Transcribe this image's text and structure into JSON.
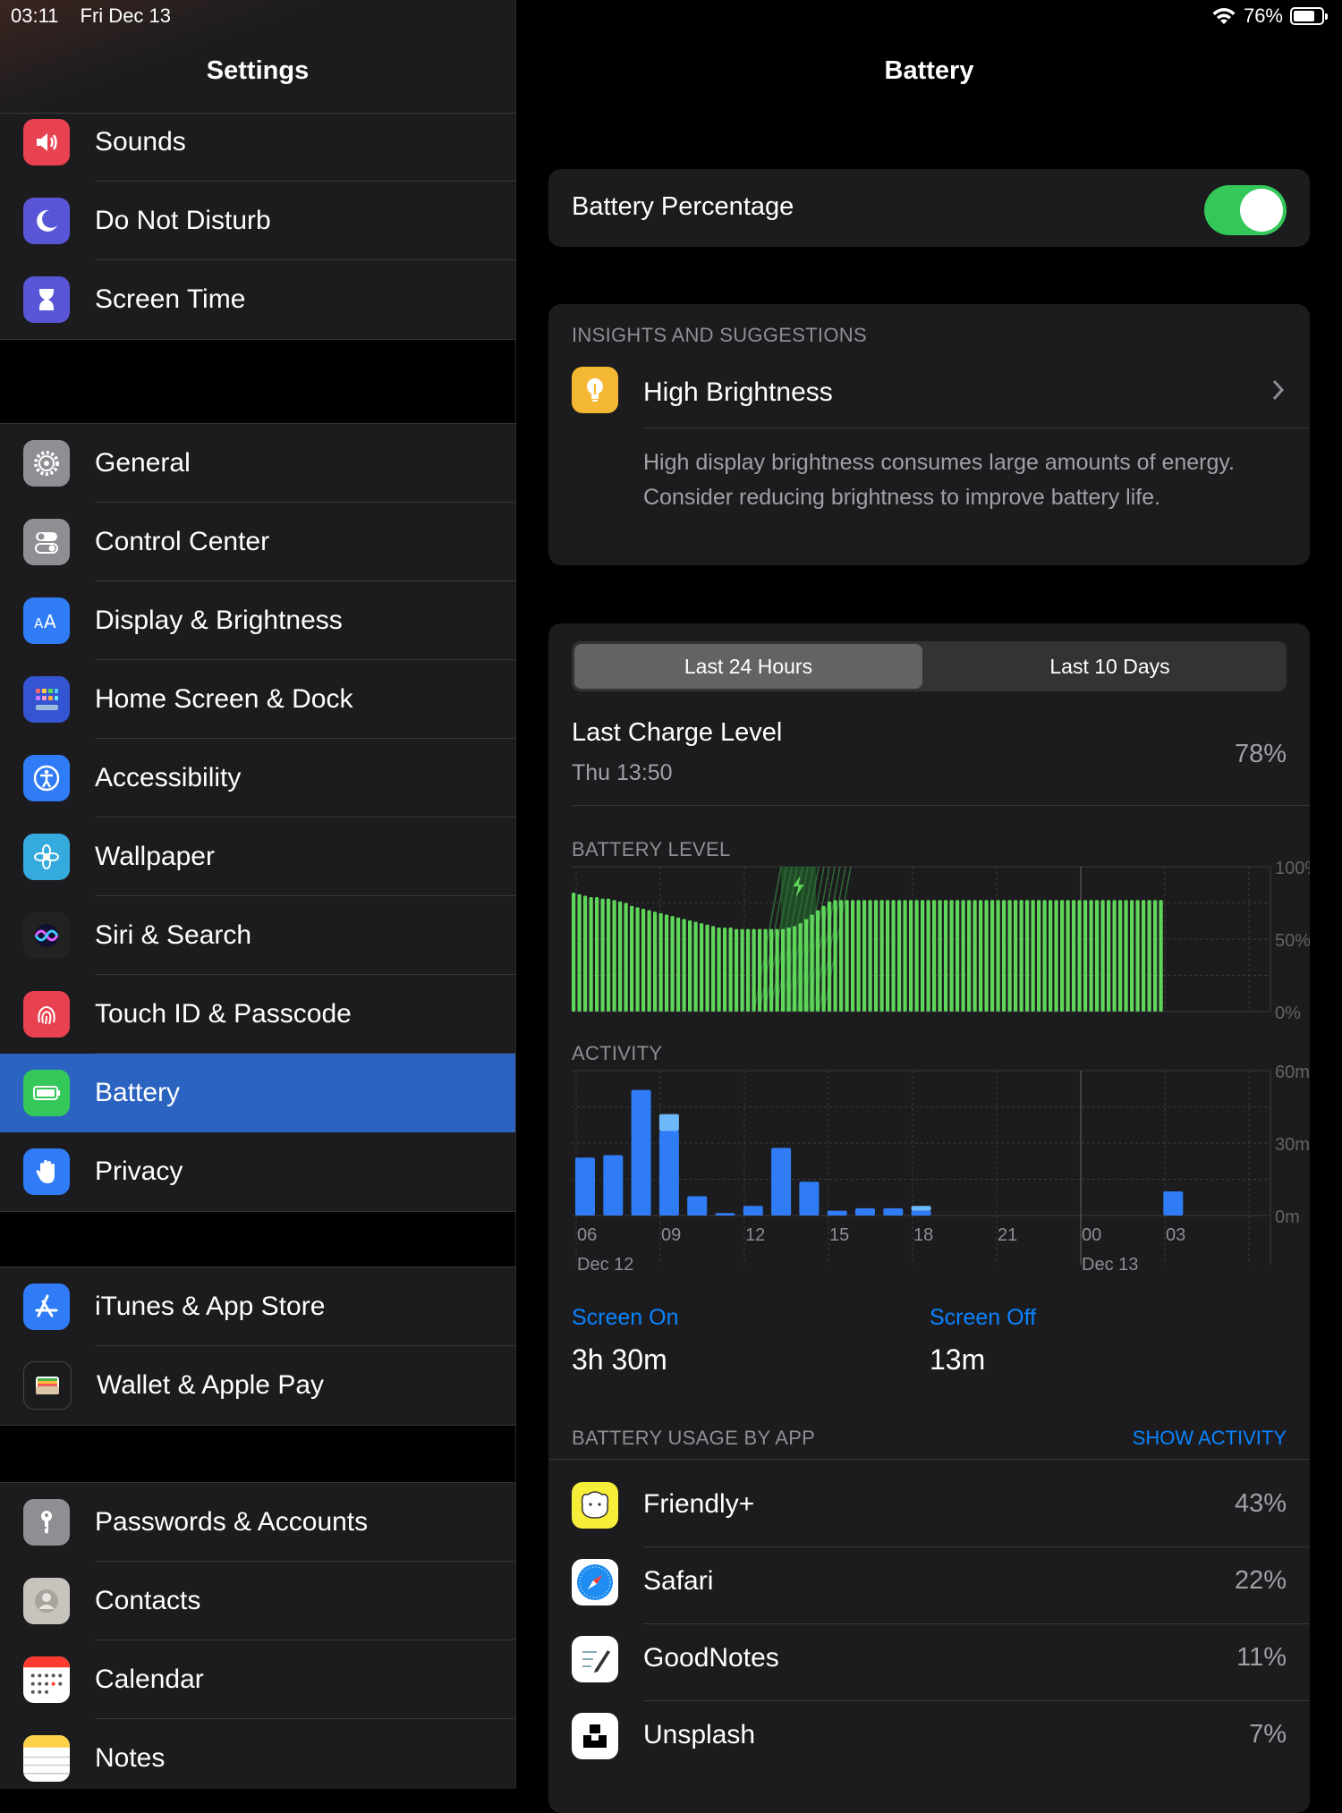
{
  "status_bar": {
    "time": "03:11",
    "date": "Fri Dec 13",
    "battery_percent": "76%",
    "battery_level": 0.76
  },
  "sidebar": {
    "title": "Settings",
    "groups": [
      [
        {
          "label": "Sounds",
          "icon": "speaker-icon",
          "color": "#e8414f"
        },
        {
          "label": "Do Not Disturb",
          "icon": "moon-icon",
          "color": "#5856d6"
        },
        {
          "label": "Screen Time",
          "icon": "hourglass-icon",
          "color": "#5856d6"
        }
      ],
      [
        {
          "label": "General",
          "icon": "gear-icon",
          "color": "#8e8e93"
        },
        {
          "label": "Control Center",
          "icon": "switches-icon",
          "color": "#8e8e93"
        },
        {
          "label": "Display & Brightness",
          "icon": "text-size-icon",
          "color": "#2f7cf6"
        },
        {
          "label": "Home Screen & Dock",
          "icon": "app-grid-icon",
          "color": "#3455d1"
        },
        {
          "label": "Accessibility",
          "icon": "accessibility-icon",
          "color": "#2f7cf6"
        },
        {
          "label": "Wallpaper",
          "icon": "flower-icon",
          "color": "#35aadc"
        },
        {
          "label": "Siri & Search",
          "icon": "siri-icon",
          "color": "#222222"
        },
        {
          "label": "Touch ID & Passcode",
          "icon": "fingerprint-icon",
          "color": "#e8414f"
        },
        {
          "label": "Battery",
          "icon": "battery-icon",
          "color": "#34c759",
          "selected": true
        },
        {
          "label": "Privacy",
          "icon": "hand-icon",
          "color": "#2f7cf6"
        }
      ],
      [
        {
          "label": "iTunes & App Store",
          "icon": "app-store-icon",
          "color": "#2f7cf6"
        },
        {
          "label": "Wallet & Apple Pay",
          "icon": "wallet-icon",
          "color": "#1c1c1e"
        }
      ],
      [
        {
          "label": "Passwords & Accounts",
          "icon": "key-icon",
          "color": "#8e8e93"
        },
        {
          "label": "Contacts",
          "icon": "contacts-icon",
          "color": "#c8c3bc"
        },
        {
          "label": "Calendar",
          "icon": "calendar-icon",
          "color": "#ffffff"
        },
        {
          "label": "Notes",
          "icon": "notes-icon",
          "color": "#ffffff"
        }
      ]
    ]
  },
  "detail": {
    "title": "Battery",
    "battery_percentage": {
      "label": "Battery Percentage",
      "on": true
    },
    "insights": {
      "header": "INSIGHTS AND SUGGESTIONS",
      "item": "High Brightness",
      "description": "High display brightness consumes large amounts of energy. Consider reducing brightness to improve battery life."
    },
    "segments": {
      "selected": "Last 24 Hours",
      "other": "Last 10 Days"
    },
    "last_charge": {
      "label": "Last Charge Level",
      "time": "Thu 13:50",
      "value": "78%"
    },
    "battery_level_chart": {
      "label": "BATTERY LEVEL",
      "y_ticks": [
        "100%",
        "50%",
        "0%"
      ],
      "values": [
        82,
        81,
        80,
        79,
        79,
        78,
        78,
        77,
        76,
        75,
        73,
        72,
        71,
        70,
        69,
        68,
        67,
        66,
        65,
        64,
        63,
        62,
        61,
        60,
        59,
        58,
        58,
        58,
        57,
        57,
        57,
        57,
        57,
        57,
        57,
        57,
        57,
        58,
        59,
        61,
        64,
        67,
        70,
        73,
        76,
        77,
        77,
        77,
        77,
        77,
        77,
        77,
        77,
        77,
        77,
        77,
        77,
        77,
        77,
        77,
        77,
        77,
        77,
        77,
        77,
        77,
        77,
        77,
        77,
        77,
        77,
        77,
        77,
        77,
        77,
        77,
        77,
        77,
        77,
        77,
        77,
        77,
        77,
        77,
        77,
        77,
        77,
        77,
        77,
        77,
        77,
        77,
        77,
        77,
        77,
        77,
        77,
        77,
        77,
        77,
        77,
        77
      ],
      "charging_start": 36,
      "charging_end": 41
    },
    "activity_chart": {
      "label": "ACTIVITY",
      "y_ticks": [
        "60m",
        "30m",
        "0m"
      ],
      "x_labels": [
        "06",
        "09",
        "12",
        "15",
        "18",
        "21",
        "00",
        "03"
      ],
      "date_labels": [
        "Dec 12",
        "Dec 13"
      ],
      "screen_on": [
        24,
        25,
        52,
        35,
        8,
        1,
        4,
        28,
        14,
        2,
        3,
        3,
        2,
        0,
        0,
        0,
        0,
        0,
        0,
        0,
        0,
        10
      ],
      "screen_off": [
        0,
        0,
        0,
        7,
        0,
        0,
        0,
        0,
        0,
        0,
        0,
        0,
        2,
        0,
        0,
        0,
        0,
        0,
        0,
        0,
        0,
        0
      ]
    },
    "screen_on": {
      "label": "Screen On",
      "value": "3h 30m"
    },
    "screen_off": {
      "label": "Screen Off",
      "value": "13m"
    },
    "usage": {
      "header": "BATTERY USAGE BY APP",
      "show_activity": "SHOW ACTIVITY",
      "apps": [
        {
          "name": "Friendly+",
          "value": "43%",
          "icon": "friendly-icon"
        },
        {
          "name": "Safari",
          "value": "22%",
          "icon": "safari-icon"
        },
        {
          "name": "GoodNotes",
          "value": "11%",
          "icon": "goodnotes-icon"
        },
        {
          "name": "Unsplash",
          "value": "7%",
          "icon": "unsplash-icon"
        }
      ]
    },
    "colors": {
      "accent": "#0a84ff",
      "battery_green": "#5fd65a",
      "toggle_on": "#34c759",
      "screen_on": "#2f7cf6",
      "screen_off": "#6cb8f8"
    }
  }
}
